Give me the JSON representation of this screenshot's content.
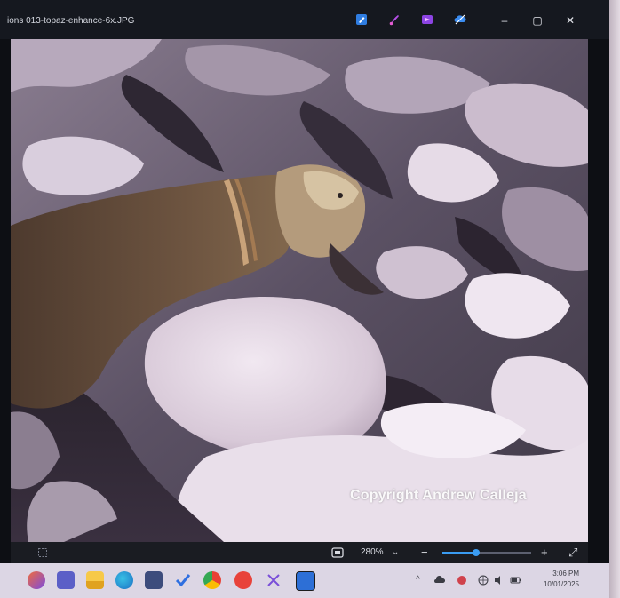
{
  "window": {
    "title": "ions 013-topaz-enhance-6x.JPG",
    "controls": {
      "minimize": "–",
      "maximize": "▢",
      "close": "✕"
    }
  },
  "photo": {
    "watermark": "Copyright Andrew Calleja"
  },
  "zoombar": {
    "zoom_label": "280%",
    "zoom_dropdown_glyph": "⌄",
    "zoom_out_glyph": "−",
    "zoom_in_glyph": "+",
    "expand_glyph": "⤢",
    "zoom_slider_level": 0.38
  },
  "taskbar": {
    "tray_chevron": "^",
    "time": "3:06 PM",
    "date": "10/01/2025"
  },
  "colors": {
    "titlebar_bg": "#15181f",
    "accent": "#3a9cf2",
    "taskbar_bg": "#dcd6e4"
  }
}
